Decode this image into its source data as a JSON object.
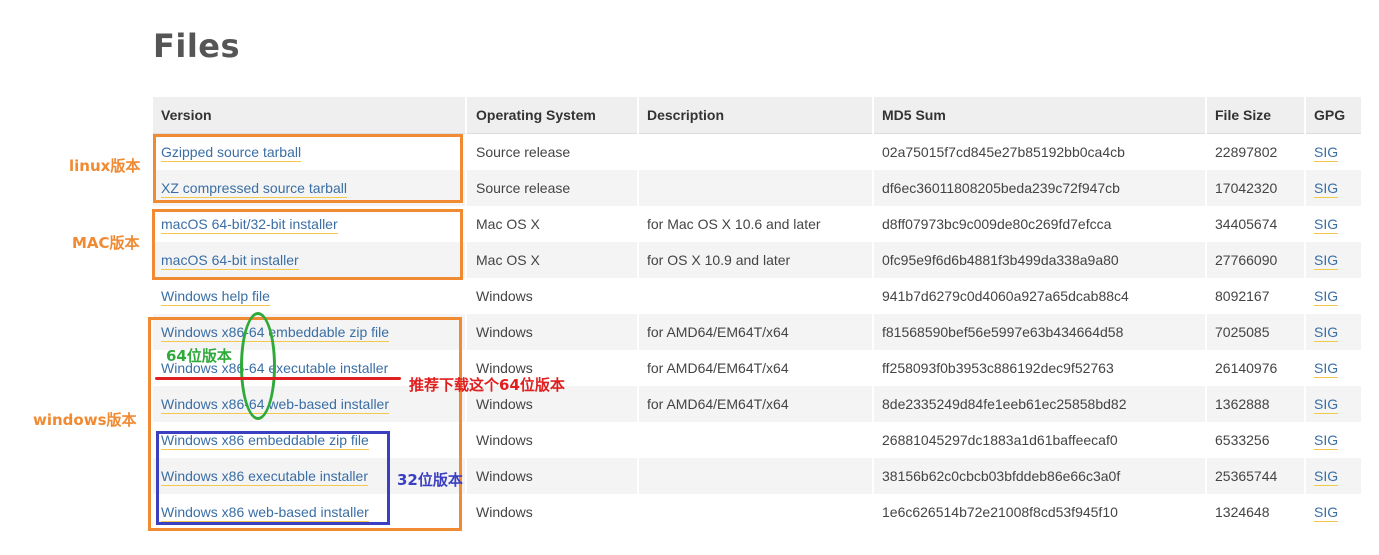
{
  "page": {
    "title": "Files"
  },
  "table": {
    "headers": [
      "Version",
      "Operating System",
      "Description",
      "MD5 Sum",
      "File Size",
      "GPG"
    ],
    "rows": [
      {
        "version": "Gzipped source tarball",
        "os": "Source release",
        "description": "",
        "md5": "02a75015f7cd845e27b85192bb0ca4cb",
        "size": "22897802",
        "gpg": "SIG"
      },
      {
        "version": "XZ compressed source tarball",
        "os": "Source release",
        "description": "",
        "md5": "df6ec36011808205beda239c72f947cb",
        "size": "17042320",
        "gpg": "SIG"
      },
      {
        "version": "macOS 64-bit/32-bit installer",
        "os": "Mac OS X",
        "description": "for Mac OS X 10.6 and later",
        "md5": "d8ff07973bc9c009de80c269fd7efcca",
        "size": "34405674",
        "gpg": "SIG"
      },
      {
        "version": "macOS 64-bit installer",
        "os": "Mac OS X",
        "description": "for OS X 10.9 and later",
        "md5": "0fc95e9f6d6b4881f3b499da338a9a80",
        "size": "27766090",
        "gpg": "SIG"
      },
      {
        "version": "Windows help file",
        "os": "Windows",
        "description": "",
        "md5": "941b7d6279c0d4060a927a65dcab88c4",
        "size": "8092167",
        "gpg": "SIG"
      },
      {
        "version": "Windows x86-64 embeddable zip file",
        "os": "Windows",
        "description": "for AMD64/EM64T/x64",
        "md5": "f81568590bef56e5997e63b434664d58",
        "size": "7025085",
        "gpg": "SIG"
      },
      {
        "version": "Windows x86-64 executable installer",
        "os": "Windows",
        "description": "for AMD64/EM64T/x64",
        "md5": "ff258093f0b3953c886192dec9f52763",
        "size": "26140976",
        "gpg": "SIG"
      },
      {
        "version": "Windows x86-64 web-based installer",
        "os": "Windows",
        "description": "for AMD64/EM64T/x64",
        "md5": "8de2335249d84fe1eeb61ec25858bd82",
        "size": "1362888",
        "gpg": "SIG"
      },
      {
        "version": "Windows x86 embeddable zip file",
        "os": "Windows",
        "description": "",
        "md5": "26881045297dc1883a1d61baffeecaf0",
        "size": "6533256",
        "gpg": "SIG"
      },
      {
        "version": "Windows x86 executable installer",
        "os": "Windows",
        "description": "",
        "md5": "38156b62c0cbcb03bfddeb86e66c3a0f",
        "size": "25365744",
        "gpg": "SIG"
      },
      {
        "version": "Windows x86 web-based installer",
        "os": "Windows",
        "description": "",
        "md5": "1e6c626514b72e21008f8cd53f945f10",
        "size": "1324648",
        "gpg": "SIG"
      }
    ]
  },
  "annotations": {
    "linux_label": "linux版本",
    "mac_label": "MAC版本",
    "windows_label": "windows版本",
    "win64_label": "64位版本",
    "recommend_label": "推荐下载这个64位版本",
    "win32_label": "32位版本",
    "colors": {
      "orange": "#f08a33",
      "green": "#2faa3a",
      "red": "#e02020",
      "blue": "#3b3fc2",
      "link": "#3a6ea5"
    }
  }
}
